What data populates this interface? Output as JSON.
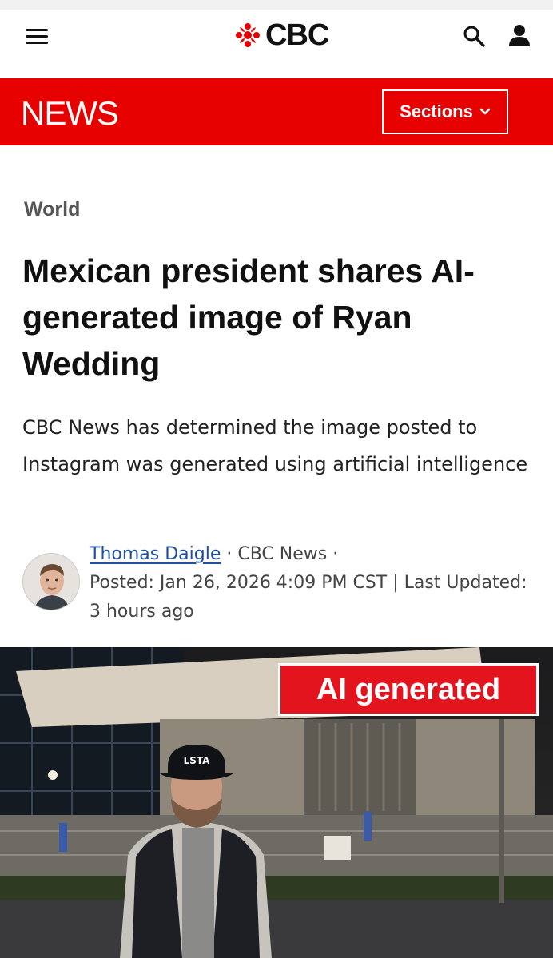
{
  "brand": {
    "name": "CBC"
  },
  "header": {
    "menu_icon": "hamburger-menu-icon",
    "search_icon": "search-icon",
    "account_icon": "user-account-icon"
  },
  "newsbar": {
    "title": "NEWS",
    "sections_label": "Sections"
  },
  "article": {
    "category": "World",
    "headline": "Mexican president shares AI-generated image of Ryan Wedding",
    "dek": "CBC News has determined the image posted to Instagram was generated using artificial intelligence",
    "author": "Thomas Daigle",
    "outlet": "CBC News",
    "posted": "Posted: Jan 26, 2026 4:09 PM CST | Last Updated: 3 hours ago",
    "image_label": "AI generated"
  },
  "colors": {
    "accent": "#e60000",
    "link": "#1f4fa3"
  }
}
